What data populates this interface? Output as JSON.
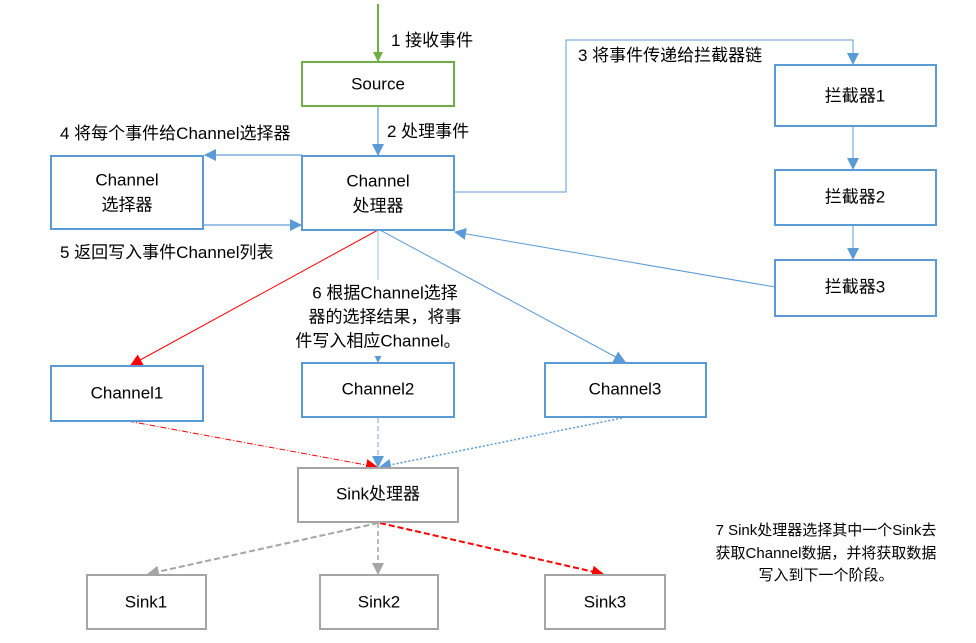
{
  "nodes": {
    "source": "Source",
    "channel_selector": [
      "Channel",
      "选择器"
    ],
    "channel_processor": [
      "Channel",
      "处理器"
    ],
    "interceptor1": "拦截器1",
    "interceptor2": "拦截器2",
    "interceptor3": "拦截器3",
    "channel1": "Channel1",
    "channel2": "Channel2",
    "channel3": "Channel3",
    "sink_processor": "Sink处理器",
    "sink1": "Sink1",
    "sink2": "Sink2",
    "sink3": "Sink3"
  },
  "steps": {
    "s1": "1 接收事件",
    "s2": "2 处理事件",
    "s3": "3 将事件传递给拦截器链",
    "s4": "4 将每个事件给Channel选择器",
    "s5": "5 返回写入事件Channel列表",
    "s6": [
      "6 根据Channel选择",
      "器的选择结果，将事",
      "件写入相应Channel。"
    ],
    "s7": [
      "7 Sink处理器选择其中一个Sink去",
      "获取Channel数据，并将获取数据",
      "写入到下一个阶段。"
    ]
  },
  "colors": {
    "source_border": "#70ad47",
    "channel_border": "#5b9bd5",
    "sink_border": "#a5a5a5",
    "selected_path": "#ff0000"
  }
}
